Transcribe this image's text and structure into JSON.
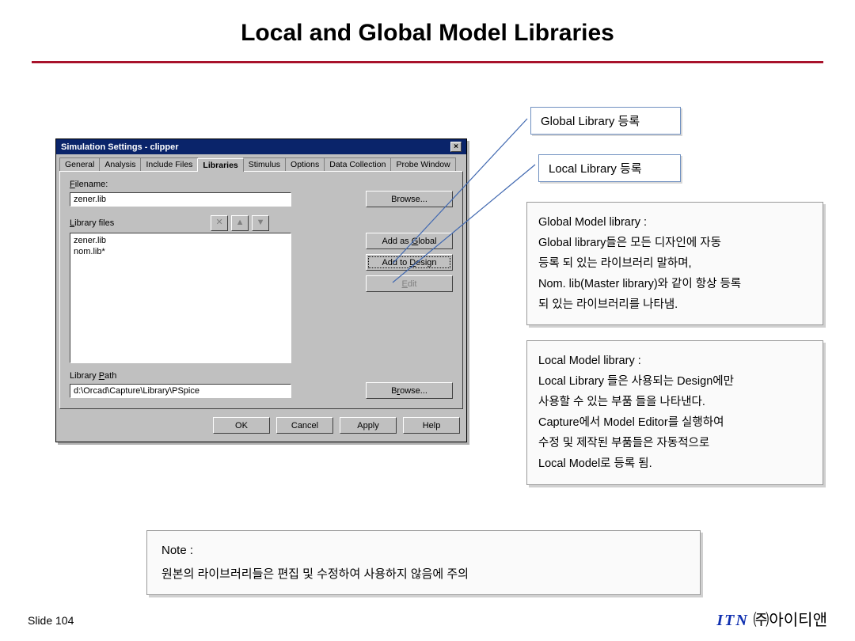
{
  "title": "Local and Global Model Libraries",
  "callouts": {
    "global": "Global Library 등록",
    "local": "Local Library 등록"
  },
  "explain_global": {
    "heading": "Global Model library :",
    "l1": "Global library들은 모든 디자인에 자동",
    "l2": "등록 되 있는 라이브러리 말하며,",
    "l3": "Nom. lib(Master library)와 같이 항상 등록",
    "l4": "되 있는 라이브러리를 나타냄."
  },
  "explain_local": {
    "heading": "Local Model library :",
    "l1": "Local Library 들은 사용되는 Design에만",
    "l2": "사용할 수 있는 부품 들을 나타낸다.",
    "l3": "Capture에서 Model Editor를 실행하여",
    "l4": "수정 및 제작된 부품들은 자동적으로",
    "l5": "Local Model로 등록 됨."
  },
  "note": {
    "heading": "Note :",
    "body": "원본의 라이브러리들은 편집 및 수정하여 사용하지 않음에 주의"
  },
  "slide_num": "Slide 104",
  "footer": {
    "itn": "ITN",
    "rest": " ㈜아이티앤"
  },
  "dialog": {
    "title": "Simulation Settings - clipper",
    "tabs": [
      "General",
      "Analysis",
      "Include Files",
      "Libraries",
      "Stimulus",
      "Options",
      "Data Collection",
      "Probe Window"
    ],
    "active_tab": "Libraries",
    "filename_label": "Filename:",
    "filename_value": "zener.lib",
    "browse": "Browse...",
    "library_files_label": "Library files",
    "library_files": [
      "zener.lib",
      "nom.lib*"
    ],
    "add_global": "Add as Global",
    "add_design": "Add to Design",
    "edit": "Edit",
    "library_path_label": "Library Path",
    "library_path_value": "d:\\Orcad\\Capture\\Library\\PSpice",
    "ok": "OK",
    "cancel": "Cancel",
    "apply": "Apply",
    "help": "Help"
  }
}
